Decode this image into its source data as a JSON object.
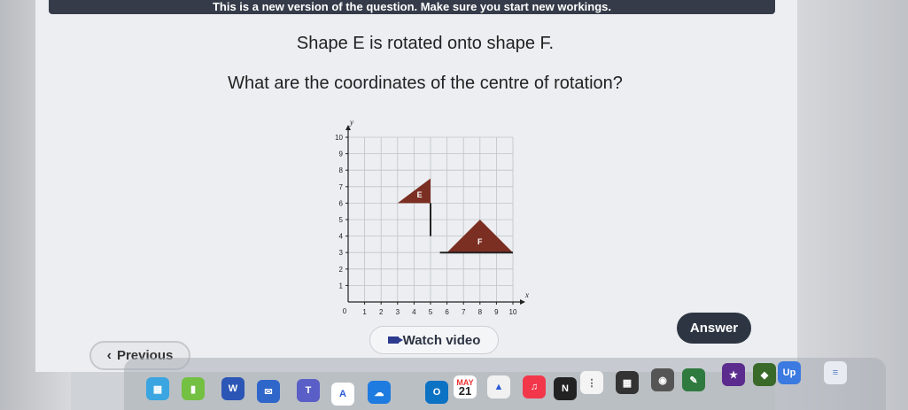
{
  "banner": "This is a new version of the question. Make sure you start new workings.",
  "question": {
    "line1": "Shape E is rotated onto shape F.",
    "line2": "What are the coordinates of the centre of rotation?"
  },
  "buttons": {
    "previous": "Previous",
    "watch_video": "Watch video",
    "answer": "Answer"
  },
  "chart_data": {
    "type": "grid",
    "xlabel": "x",
    "ylabel": "y",
    "xlim": [
      0,
      10
    ],
    "ylim": [
      0,
      10
    ],
    "x_ticks": [
      "1",
      "2",
      "3",
      "4",
      "5",
      "6",
      "7",
      "8",
      "9",
      "10"
    ],
    "y_ticks": [
      "1",
      "2",
      "3",
      "4",
      "5",
      "6",
      "7",
      "8",
      "9",
      "10"
    ],
    "origin_label": "0",
    "shapes": [
      {
        "name": "E",
        "color": "#7b2e22",
        "points": [
          [
            3,
            6
          ],
          [
            5,
            6
          ],
          [
            5,
            7.5
          ]
        ],
        "line": [
          [
            5,
            6
          ],
          [
            5,
            4
          ]
        ]
      },
      {
        "name": "F",
        "color": "#7b2e22",
        "points": [
          [
            6,
            3
          ],
          [
            10,
            3
          ],
          [
            8,
            5
          ]
        ],
        "line": [
          [
            6,
            3
          ],
          [
            6,
            3
          ]
        ]
      }
    ]
  },
  "dock": {
    "calendar_month": "MAY",
    "calendar_day": "21",
    "icons": [
      "launchpad-icon",
      "word-icon",
      "mail-icon",
      "teams-icon",
      "font-icon",
      "cloud-icon",
      "outlook-icon",
      "calendar-icon",
      "notes-icon",
      "music-icon",
      "notion-icon",
      "reminders-icon",
      "calculator-icon",
      "chrome-icon",
      "pencil-icon",
      "game-icon",
      "up-icon",
      "up-app-icon",
      "preview-icon"
    ]
  }
}
